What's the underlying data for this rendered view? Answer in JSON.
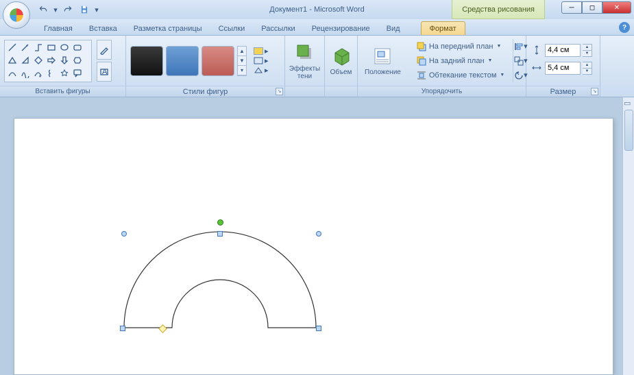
{
  "title": "Документ1 - Microsoft Word",
  "context_tool": "Средства рисования",
  "tabs": {
    "home": "Главная",
    "insert": "Вставка",
    "layout": "Разметка страницы",
    "references": "Ссылки",
    "mailings": "Рассылки",
    "review": "Рецензирование",
    "view": "Вид",
    "format": "Формат"
  },
  "groups": {
    "insert_shapes": "Вставить фигуры",
    "shape_styles": "Стили фигур",
    "shadow_effects": "Эффекты тени",
    "threeD": "Объем",
    "position": "Положение",
    "arrange": "Упорядочить",
    "size": "Размер"
  },
  "big_buttons": {
    "shadow": "Эффекты\nтени",
    "threeD": "Объем",
    "position": "Положение"
  },
  "arrange": {
    "bring_front": "На передний план",
    "send_back": "На задний план",
    "text_wrap": "Обтекание текстом"
  },
  "size": {
    "height": "4,4 см",
    "width": "5,4 см"
  }
}
